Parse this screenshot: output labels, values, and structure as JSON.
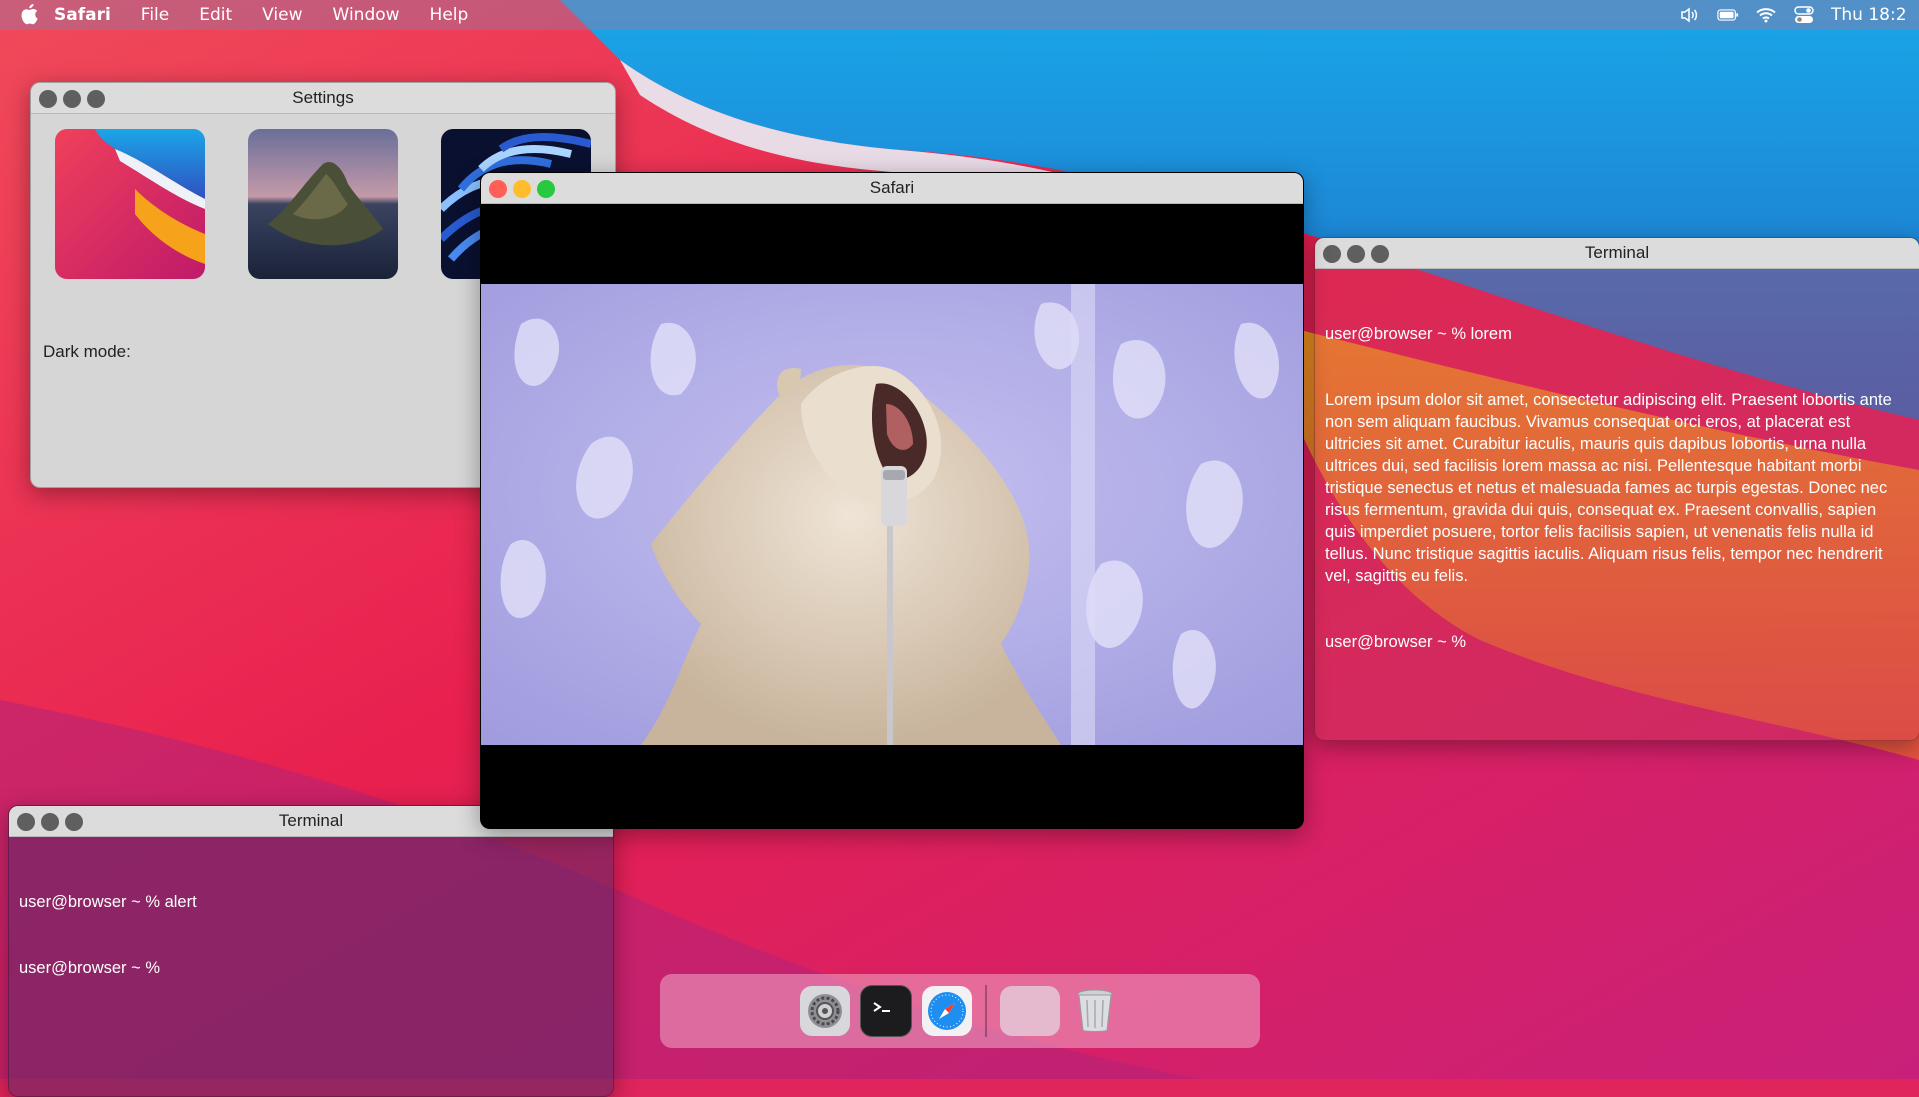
{
  "menubar": {
    "app_name": "Safari",
    "menus": [
      "File",
      "Edit",
      "View",
      "Window",
      "Help"
    ],
    "status_icons": [
      "volume-icon",
      "battery-icon",
      "wifi-icon",
      "control-center-icon"
    ],
    "clock": "Thu 18:2"
  },
  "settings_window": {
    "title": "Settings",
    "wallpapers": [
      "big-sur-wallpaper",
      "catalina-island-wallpaper",
      "blue-petals-wallpaper"
    ],
    "dark_mode_label": "Dark mode:"
  },
  "safari_window": {
    "title": "Safari",
    "video_subject": "cat-singing-into-microphone"
  },
  "terminal_right": {
    "title": "Terminal",
    "lines": [
      "user@browser ~ % lorem",
      "Lorem ipsum dolor sit amet, consectetur adipiscing elit. Praesent lobortis ante non sem aliquam faucibus. Vivamus consequat orci eros, at placerat est ultricies sit amet. Curabitur iaculis, mauris quis dapibus lobortis, urna nulla ultrices dui, sed facilisis lorem massa ac nisi. Pellentesque habitant morbi tristique senectus et netus et malesuada fames ac turpis egestas. Donec nec risus fermentum, gravida dui quis, consequat ex. Praesent convallis, sapien quis imperdiet posuere, tortor felis facilisis sapien, ut venenatis felis nulla id tellus. Nunc tristique sagittis iaculis. Aliquam risus felis, tempor nec hendrerit vel, sagittis eu felis.",
      "user@browser ~ %"
    ]
  },
  "terminal_left": {
    "title": "Terminal",
    "lines": [
      "user@browser ~ % alert",
      "user@browser ~ %"
    ]
  },
  "dock": {
    "apps": [
      "settings-icon",
      "terminal-icon",
      "safari-icon",
      "empty-slot",
      "trash-icon"
    ]
  },
  "colors": {
    "light_red": "#ff5f56",
    "light_yellow": "#ffbd2e",
    "light_green": "#27c93f",
    "light_inactive": "#5f5f5f"
  }
}
